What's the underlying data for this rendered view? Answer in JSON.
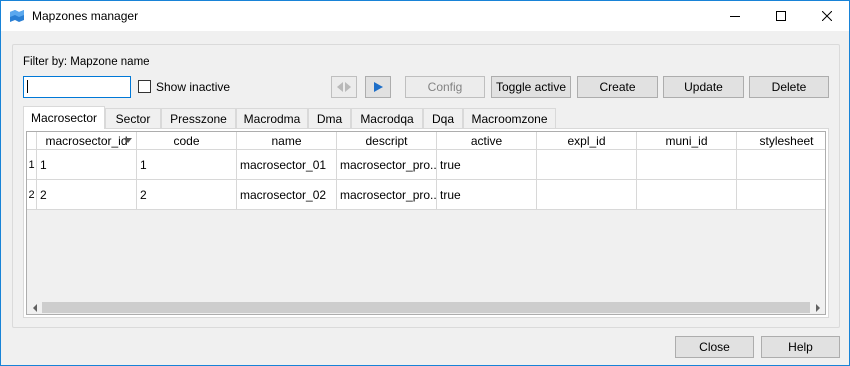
{
  "window": {
    "title": "Mapzones manager",
    "accent": "#0078d7"
  },
  "filter": {
    "label": "Filter by: Mapzone name",
    "search_value": "",
    "show_inactive_label": "Show inactive",
    "show_inactive_checked": false
  },
  "toolbar": {
    "prev_icon": "double-arrow-icon",
    "next_icon": "play-icon",
    "config_label": "Config",
    "toggle_active_label": "Toggle active",
    "create_label": "Create",
    "update_label": "Update",
    "delete_label": "Delete"
  },
  "tabs": [
    {
      "label": "Macrosector",
      "active": true
    },
    {
      "label": "Sector",
      "active": false
    },
    {
      "label": "Presszone",
      "active": false
    },
    {
      "label": "Macrodma",
      "active": false
    },
    {
      "label": "Dma",
      "active": false
    },
    {
      "label": "Macrodqa",
      "active": false
    },
    {
      "label": "Dqa",
      "active": false
    },
    {
      "label": "Macroomzone",
      "active": false
    }
  ],
  "table": {
    "columns": [
      "macrosector_id",
      "code",
      "name",
      "descript",
      "active",
      "expl_id",
      "muni_id",
      "stylesheet"
    ],
    "sorted_column": "macrosector_id",
    "row_numbers": [
      "1",
      "2"
    ],
    "rows": [
      [
        "1",
        "1",
        "macrosector_01",
        "macrosector_pro...",
        "true",
        "",
        "",
        ""
      ],
      [
        "2",
        "2",
        "macrosector_02",
        "macrosector_pro...",
        "true",
        "",
        "",
        ""
      ]
    ]
  },
  "footer": {
    "close_label": "Close",
    "help_label": "Help"
  }
}
